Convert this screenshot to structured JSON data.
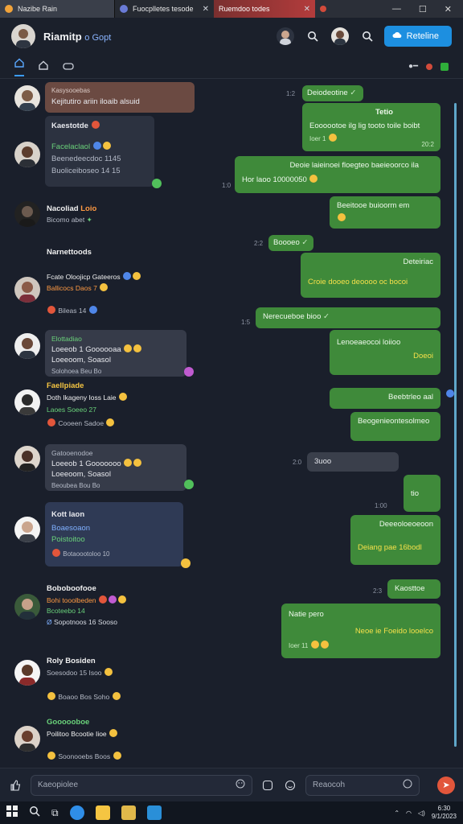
{
  "browser": {
    "tabs": [
      {
        "label": "Nazibe Rain"
      },
      {
        "label": "Fuocplletes tesode"
      },
      {
        "label": "Ruemdoo todes"
      }
    ]
  },
  "header": {
    "title": "Riamitp",
    "title_suffix": "o Gopt",
    "primary_button": "Reteline"
  },
  "messages_in": [
    {
      "name": "",
      "text": "Kasysooebas",
      "sub": "Kejitutiro ariin iloaib alsuid",
      "extra": ""
    },
    {
      "name": "Kaestotde",
      "line1": "Facelaclaol",
      "line2": "Beenedeecdoc 1145",
      "line3": "Buoliceiboseo 14 15"
    },
    {
      "name": "Nacoliad",
      "line1": "Bicomo abet"
    },
    {
      "name": "Narnettoods",
      "line1": "Fcate Oloojicp Gateeros",
      "line2": "Ballicocs Daos 7",
      "line3": "Bileas 14"
    },
    {
      "name": "Elottadiao",
      "line1": "Loeeob 1 Goooooaa",
      "line2": "Loeeoom, Soasol",
      "line3": "Solohoea Beu Bo"
    },
    {
      "name": "Faellpiade",
      "line1": "Doth Ikageny Ioss Laie",
      "line2": "Laoes Soeeo 27",
      "line3": "Cooeen Sadoe"
    },
    {
      "name": "Gatooenodoe",
      "line1": "Loeeob 1 Gooooooo",
      "line2": "Loeeoom, Soasol",
      "line3": "Beoubea Bou Bo"
    },
    {
      "name": "Kott laon",
      "line1": "Boaesoaon",
      "line2": "Poistoitoo",
      "line3": "Botaoootoloo 10"
    },
    {
      "name": "Boboboofooe",
      "line1": "Bohi tooolbeden",
      "line2": "Bcoteebo 14",
      "line3": "Sopotnoos 16 Sooso"
    },
    {
      "name": "Roly Bosiden",
      "line1": "Soesodoo 15 Isoo",
      "line2": "Boaoo Bos Soho"
    },
    {
      "name": "Goooooboe",
      "line1": "Poilitoo Bcootie Iioe",
      "line2": "Soonooebs Boos"
    }
  ],
  "messages_out": [
    {
      "text": "Deiodeotine",
      "time": "1:2"
    },
    {
      "title": "Tetio",
      "text": "Eoooootoe ilg lig tooto toile boibt",
      "time": "20:2"
    },
    {
      "text": "Deoie laieinoei floegteo baeieoorco ila",
      "sub": "Hor laoo 10000050",
      "time": "1:0"
    },
    {
      "text": "Beeitooe buioorm em",
      "time": ""
    },
    {
      "text": "Boooeo",
      "time": "2:2"
    },
    {
      "title": "Deteiriac",
      "text": "Croie dooeo deoooo oc bocoi",
      "time": ""
    },
    {
      "text": "Nerecueboe bioo",
      "time": "1:5"
    },
    {
      "title": "Lenoeaeocoi loiioo",
      "sub": "Doeoi",
      "time": ""
    },
    {
      "text": "Beebtrleo aal",
      "time": ""
    },
    {
      "text": "Beogenieontesolmeo",
      "time": ""
    },
    {
      "text": "3uoo",
      "grey": true,
      "time": "2:0"
    },
    {
      "text": "tio",
      "time": "1:00"
    },
    {
      "title": "Deeeoloeoeoon",
      "text": "Deiang pae 16bodl",
      "time": ""
    },
    {
      "text": "Kaosttoe",
      "time": "2:3"
    },
    {
      "title": "Natie pero",
      "text": "Neoe ie Foeido looelco",
      "sub": "Ioer 11",
      "time": ""
    }
  ],
  "composer": {
    "placeholder": "Kaeopiolee",
    "secondary_placeholder": "Reaocoh"
  },
  "taskbar": {
    "time": "6:30",
    "date": "9/1/2023"
  },
  "colors": {
    "accent": "#1d8fe0",
    "outgoing_bubble": "#3f8a3a",
    "incoming_bubble": "#363b49",
    "background": "#1a1f2b"
  }
}
